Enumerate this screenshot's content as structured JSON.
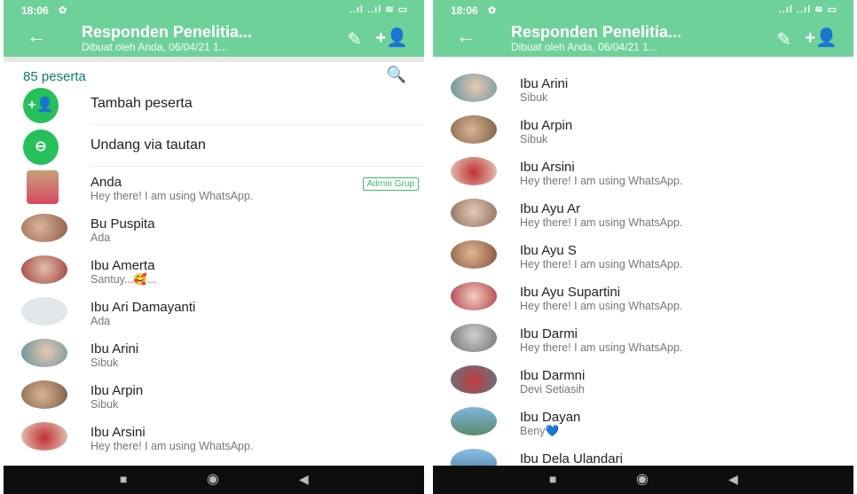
{
  "colors": {
    "header": "#6fd19a",
    "accent": "#0a7d68",
    "action_green": "#25c05a",
    "badge": "#3fb873"
  },
  "status_bar": {
    "time": "18:06",
    "icons": "..ıl ..ıl ≋ ▭"
  },
  "header": {
    "title": "Responden Penelitia...",
    "subtitle": "Dibuat oleh Anda, 06/04/21 1..."
  },
  "icons": {
    "back": "←",
    "edit": "✎",
    "add_participant": "+👤",
    "search": "🔍",
    "add_circle": "+👤",
    "link": "⊖",
    "nav_square": "■",
    "nav_circle": "◉",
    "nav_back": "◀"
  },
  "participants_count": "85 peserta",
  "actions": [
    {
      "label": "Tambah peserta"
    },
    {
      "label": "Undang via tautan"
    }
  ],
  "admin_badge": "Admin Grup",
  "left_contacts": [
    {
      "name": "Anda",
      "status": "Hey there! I am using WhatsApp."
    },
    {
      "name": "Bu Puspita",
      "status": "Ada"
    },
    {
      "name": "Ibu Amerta",
      "status": "Santuy...🥰..."
    },
    {
      "name": "Ibu Ari Damayanti",
      "status": "Ada"
    },
    {
      "name": "Ibu Arini",
      "status": "Sibuk"
    },
    {
      "name": "Ibu Arpin",
      "status": "Sibuk"
    },
    {
      "name": "Ibu Arsini",
      "status": "Hey there! I am using WhatsApp."
    }
  ],
  "right_contacts": [
    {
      "name": "Ibu Arini",
      "status": "Sibuk"
    },
    {
      "name": "Ibu Arpin",
      "status": "Sibuk"
    },
    {
      "name": "Ibu Arsini",
      "status": "Hey there! I am using WhatsApp."
    },
    {
      "name": "Ibu Ayu Ar",
      "status": "Hey there! I am using WhatsApp."
    },
    {
      "name": "Ibu Ayu S",
      "status": "Hey there! I am using WhatsApp."
    },
    {
      "name": "Ibu Ayu Supartini",
      "status": "Hey there! I am using WhatsApp."
    },
    {
      "name": "Ibu Darmi",
      "status": "Hey there! I am using WhatsApp."
    },
    {
      "name": "Ibu Darmni",
      "status": "Devi Setiasih"
    },
    {
      "name": "Ibu Dayan",
      "status": "Beny💙"
    },
    {
      "name": "Ibu Dela Ulandari",
      "status": ""
    }
  ]
}
